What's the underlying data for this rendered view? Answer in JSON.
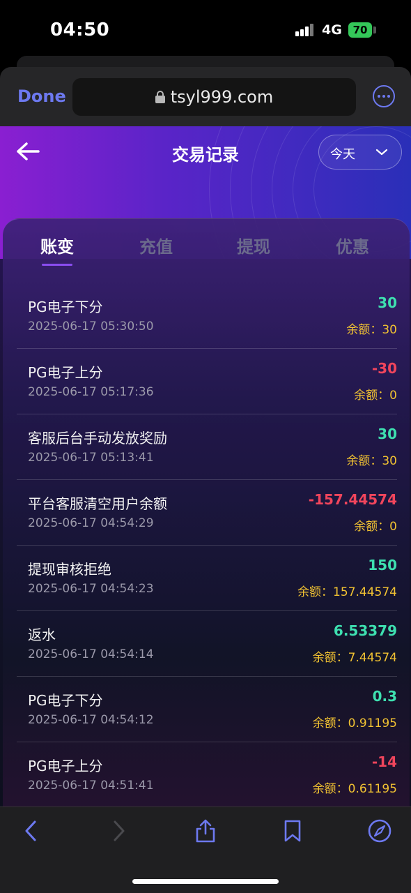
{
  "status_bar": {
    "time": "04:50",
    "network": "4G",
    "battery": "70"
  },
  "browser": {
    "done_label": "Done",
    "url": "tsyl999.com"
  },
  "header": {
    "title": "交易记录",
    "filter_value": "今天"
  },
  "tabs": [
    {
      "label": "账变",
      "active": true
    },
    {
      "label": "充值",
      "active": false
    },
    {
      "label": "提现",
      "active": false
    },
    {
      "label": "优惠",
      "active": false
    }
  ],
  "transactions": [
    {
      "title": "PG电子下分",
      "time": "2025-06-17 05:30:50",
      "amount": "30",
      "balance": "余额：30"
    },
    {
      "title": "PG电子上分",
      "time": "2025-06-17 05:17:36",
      "amount": "-30",
      "balance": "余额：0"
    },
    {
      "title": "客服后台手动发放奖励",
      "time": "2025-06-17 05:13:41",
      "amount": "30",
      "balance": "余额：30"
    },
    {
      "title": "平台客服清空用户余额",
      "time": "2025-06-17 04:54:29",
      "amount": "-157.44574",
      "balance": "余额：0"
    },
    {
      "title": "提现审核拒绝",
      "time": "2025-06-17 04:54:23",
      "amount": "150",
      "balance": "余额：157.44574"
    },
    {
      "title": "返水",
      "time": "2025-06-17 04:54:14",
      "amount": "6.53379",
      "balance": "余额：7.44574"
    },
    {
      "title": "PG电子下分",
      "time": "2025-06-17 04:54:12",
      "amount": "0.3",
      "balance": "余额：0.91195"
    },
    {
      "title": "PG电子上分",
      "time": "2025-06-17 04:51:41",
      "amount": "-14",
      "balance": "余额：0.61195"
    }
  ],
  "colors": {
    "positive": "#3ee0b0",
    "negative": "#f0455c",
    "balance": "#f1c232",
    "accent": "#6d79f0"
  },
  "toolbar_icons": [
    "back-icon",
    "forward-icon",
    "share-icon",
    "bookmarks-icon",
    "compass-icon"
  ]
}
